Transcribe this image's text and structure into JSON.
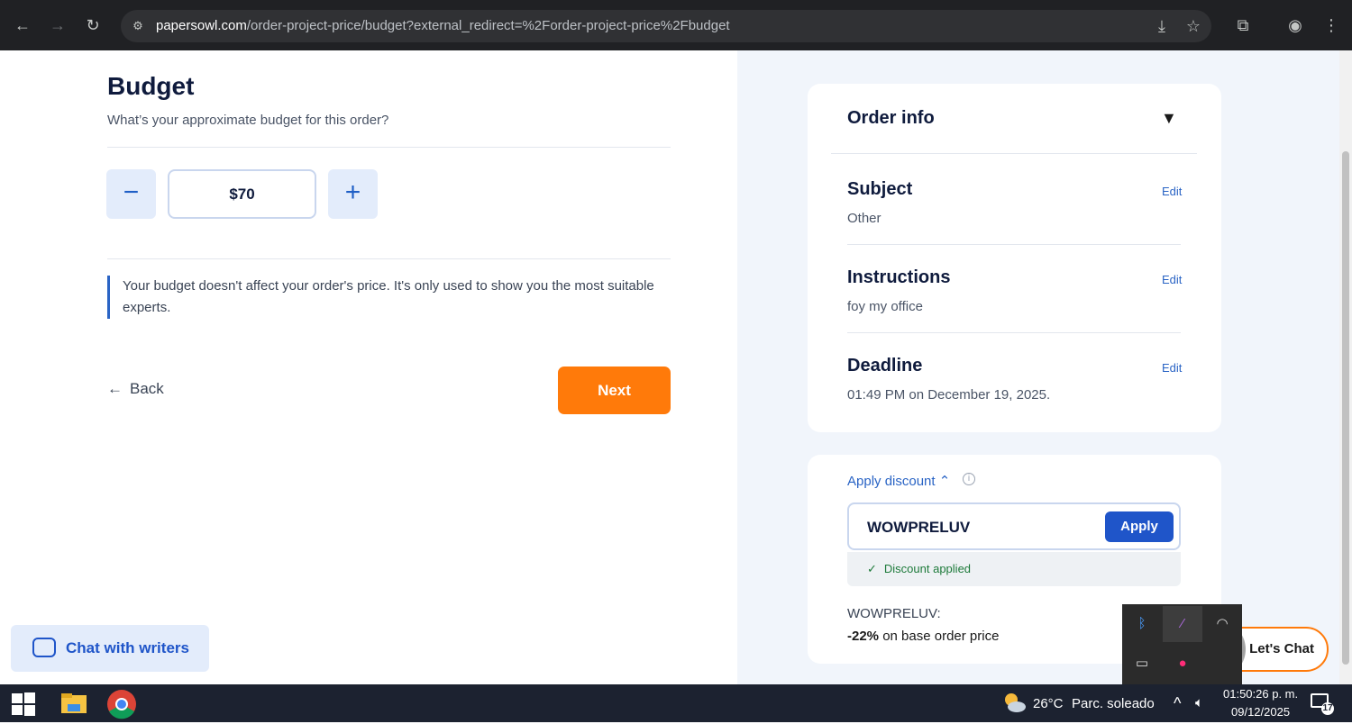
{
  "browser": {
    "url_host": "papersowl.com",
    "url_path": "/order-project-price/budget?external_redirect=%2Forder-project-price%2Fbudget"
  },
  "budget": {
    "title": "Budget",
    "subtitle": "What’s your approximate budget for this order?",
    "amount": "$70",
    "minus": "−",
    "plus": "+",
    "notice": "Your budget doesn't affect your order's price. It's only used to show you the most suitable experts.",
    "back_label": "Back",
    "next_label": "Next"
  },
  "order_info": {
    "title": "Order info",
    "caret": "▼",
    "rows": [
      {
        "label": "Subject",
        "value": "Other",
        "edit": "Edit"
      },
      {
        "label": "Instructions",
        "value": "foy my office",
        "edit": "Edit"
      },
      {
        "label": "Deadline",
        "value": "01:49 PM on December 19, 2025.",
        "edit": "Edit"
      }
    ]
  },
  "discount": {
    "toggle_label": "Apply discount",
    "code": "WOWPRELUV",
    "apply_label": "Apply",
    "applied_label": "Discount applied",
    "promo_code": "WOWPRELUV:",
    "promo_percent": "-22%",
    "promo_desc": " on base order price"
  },
  "chat": {
    "writers_label": "Chat with writers",
    "lets_chat_label": "Let's Chat"
  },
  "taskbar": {
    "weather_temp": "26°C",
    "weather_desc": "Parc. soleado",
    "time": "01:50:26 p. m.",
    "date": "09/12/2025",
    "notifications": "17"
  },
  "colors": {
    "accent": "#1f55c9",
    "cta": "#ff7a0a",
    "success": "#1d7a3a"
  }
}
